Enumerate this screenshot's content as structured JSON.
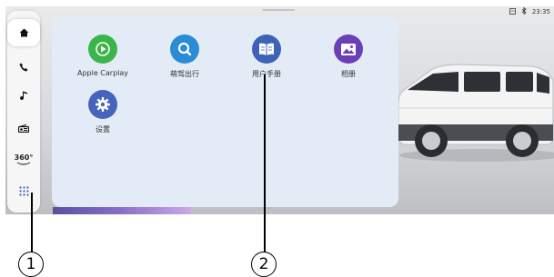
{
  "status_bar": {
    "time": "23:35",
    "icons": [
      "sim-icon",
      "bluetooth-icon"
    ]
  },
  "dock": {
    "items": [
      {
        "name": "home",
        "icon": "home-icon",
        "active": true
      },
      {
        "name": "phone",
        "icon": "phone-icon",
        "active": false
      },
      {
        "name": "music",
        "icon": "music-note-icon",
        "active": false
      },
      {
        "name": "radio",
        "icon": "radio-icon",
        "active": false
      },
      {
        "name": "camera-360",
        "icon": "360-view-icon",
        "label": "360°",
        "active": false
      },
      {
        "name": "all-apps",
        "icon": "app-grid-icon",
        "active": false
      }
    ]
  },
  "apps": [
    {
      "label": "Apple Carplay",
      "icon": "play-icon",
      "color": "#3bb54a"
    },
    {
      "label": "萌驾出行",
      "icon": "search-icon",
      "color": "#2a8bd6"
    },
    {
      "label": "用户手册",
      "icon": "book-icon",
      "color": "#3e62b8"
    },
    {
      "label": "相册",
      "icon": "image-icon",
      "color": "#6b3fb6"
    },
    {
      "label": "设置",
      "icon": "gear-icon",
      "color": "#4764bd"
    }
  ],
  "callouts": [
    {
      "label": "1"
    },
    {
      "label": "2"
    }
  ]
}
